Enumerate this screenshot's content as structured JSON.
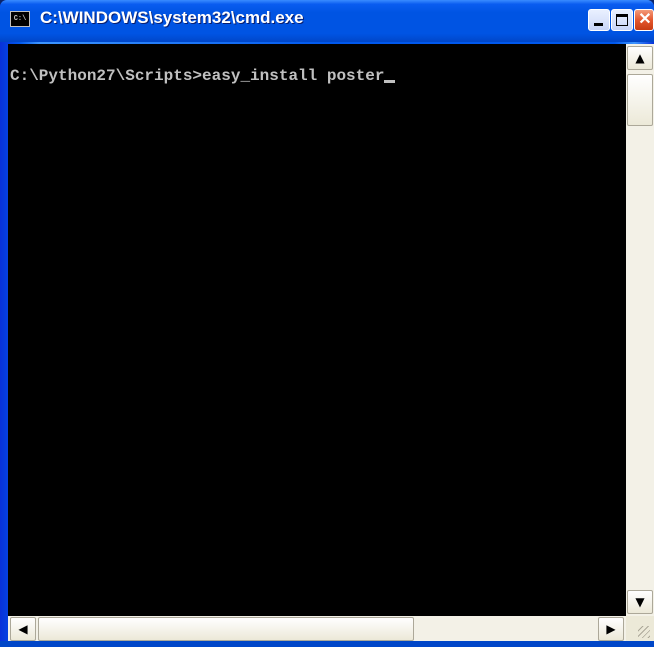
{
  "window": {
    "title": "C:\\WINDOWS\\system32\\cmd.exe",
    "icon": "cmd-icon",
    "icon_text": "C:\\"
  },
  "titlebar_buttons": {
    "minimize": "minimize-icon",
    "maximize": "maximize-icon",
    "close": "close-icon",
    "close_glyph": "✕"
  },
  "console": {
    "prompt": "C:\\Python27\\Scripts>",
    "command": "easy_install poster",
    "text_color": "#c0c0c0",
    "background": "#000000"
  },
  "scrollbars": {
    "up_arrow": "▲",
    "down_arrow": "▼",
    "left_arrow": "◀",
    "right_arrow": "▶"
  }
}
